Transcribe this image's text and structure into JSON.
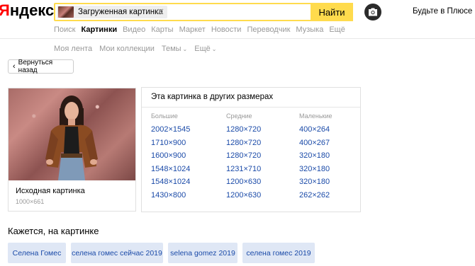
{
  "header": {
    "logo_first": "Я",
    "logo_rest": "ндекс",
    "search_chip_text": "Загруженная картинка",
    "find_label": "Найти",
    "plus_label": "Будьте в Плюсе"
  },
  "tabs": [
    "Поиск",
    "Картинки",
    "Видео",
    "Карты",
    "Маркет",
    "Новости",
    "Переводчик",
    "Музыка",
    "Ещё"
  ],
  "active_tab": "Картинки",
  "subtabs": {
    "feed": "Моя лента",
    "collections": "Мои коллекции",
    "themes": "Темы",
    "more": "Ещё"
  },
  "back_label": "Вернуться назад",
  "original": {
    "title": "Исходная картинка",
    "size": "1000×661"
  },
  "sizes": {
    "title": "Эта картинка в других размерах",
    "columns": [
      {
        "head": "Большие",
        "items": [
          "2002×1545",
          "1710×900",
          "1600×900",
          "1548×1024",
          "1548×1024",
          "1430×800"
        ]
      },
      {
        "head": "Средние",
        "items": [
          "1280×720",
          "1280×720",
          "1280×720",
          "1231×710",
          "1200×630",
          "1200×630"
        ]
      },
      {
        "head": "Маленькие",
        "items": [
          "400×264",
          "400×267",
          "320×180",
          "320×180",
          "320×180",
          "262×262"
        ]
      }
    ]
  },
  "related": {
    "title": "Кажется, на картинке",
    "tags": [
      "Селена Гомес",
      "селена гомес сейчас 2019",
      "selena gomez 2019",
      "селена гомес 2019"
    ]
  },
  "colors": {
    "accent_yellow": "#ffdb4d",
    "link_blue": "#1a4aa8",
    "logo_red": "#ff0000",
    "tag_bg": "#dfe7f5"
  },
  "icons": [
    "close-icon",
    "camera-icon",
    "chevron-left-icon",
    "chevron-down-icon"
  ]
}
